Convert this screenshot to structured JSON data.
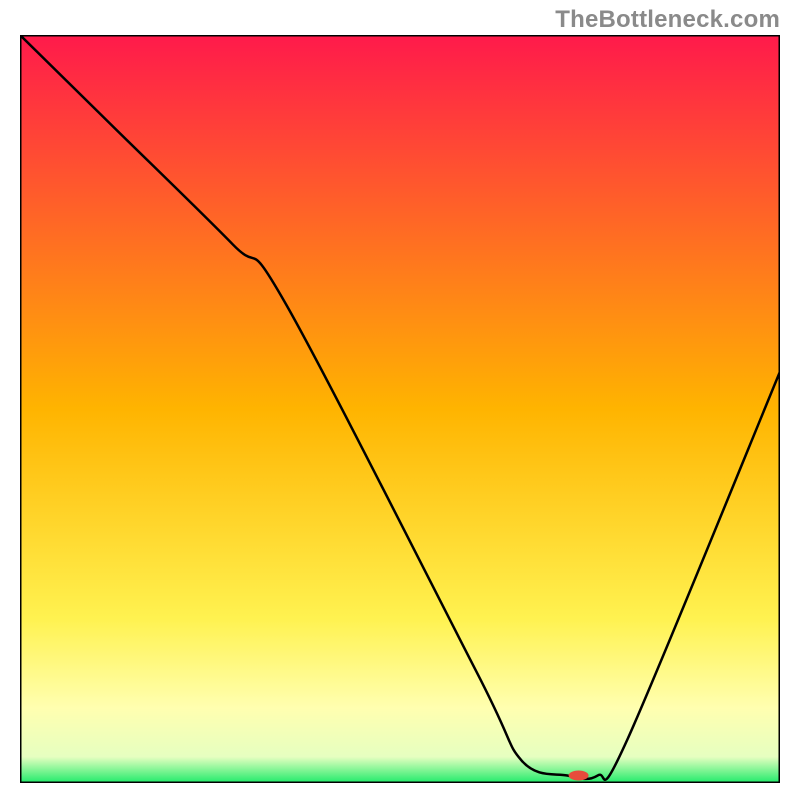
{
  "watermark": "TheBottleneck.com",
  "chart_data": {
    "type": "line",
    "title": "",
    "xlabel": "",
    "ylabel": "",
    "xlim": [
      0,
      100
    ],
    "ylim": [
      0,
      100
    ],
    "background_gradient": {
      "stops": [
        {
          "offset": 0.0,
          "color": "#ff1a4b"
        },
        {
          "offset": 0.5,
          "color": "#ffb400"
        },
        {
          "offset": 0.78,
          "color": "#fff250"
        },
        {
          "offset": 0.9,
          "color": "#ffffb0"
        },
        {
          "offset": 0.965,
          "color": "#e6ffc0"
        },
        {
          "offset": 1.0,
          "color": "#1feb6a"
        }
      ]
    },
    "series": [
      {
        "name": "bottleneck-curve",
        "x": [
          0,
          12,
          28,
          35,
          60,
          66,
          72,
          76,
          80,
          100
        ],
        "y": [
          100,
          88,
          72,
          64,
          15,
          3,
          1,
          1,
          6,
          55
        ]
      }
    ],
    "markers": [
      {
        "name": "optimal-point",
        "x": 73.5,
        "y": 1,
        "color": "#e74c3c",
        "rx": 10,
        "ry": 5
      }
    ],
    "axes_color": "#000000",
    "curve_color": "#000000",
    "curve_width": 2.5
  }
}
